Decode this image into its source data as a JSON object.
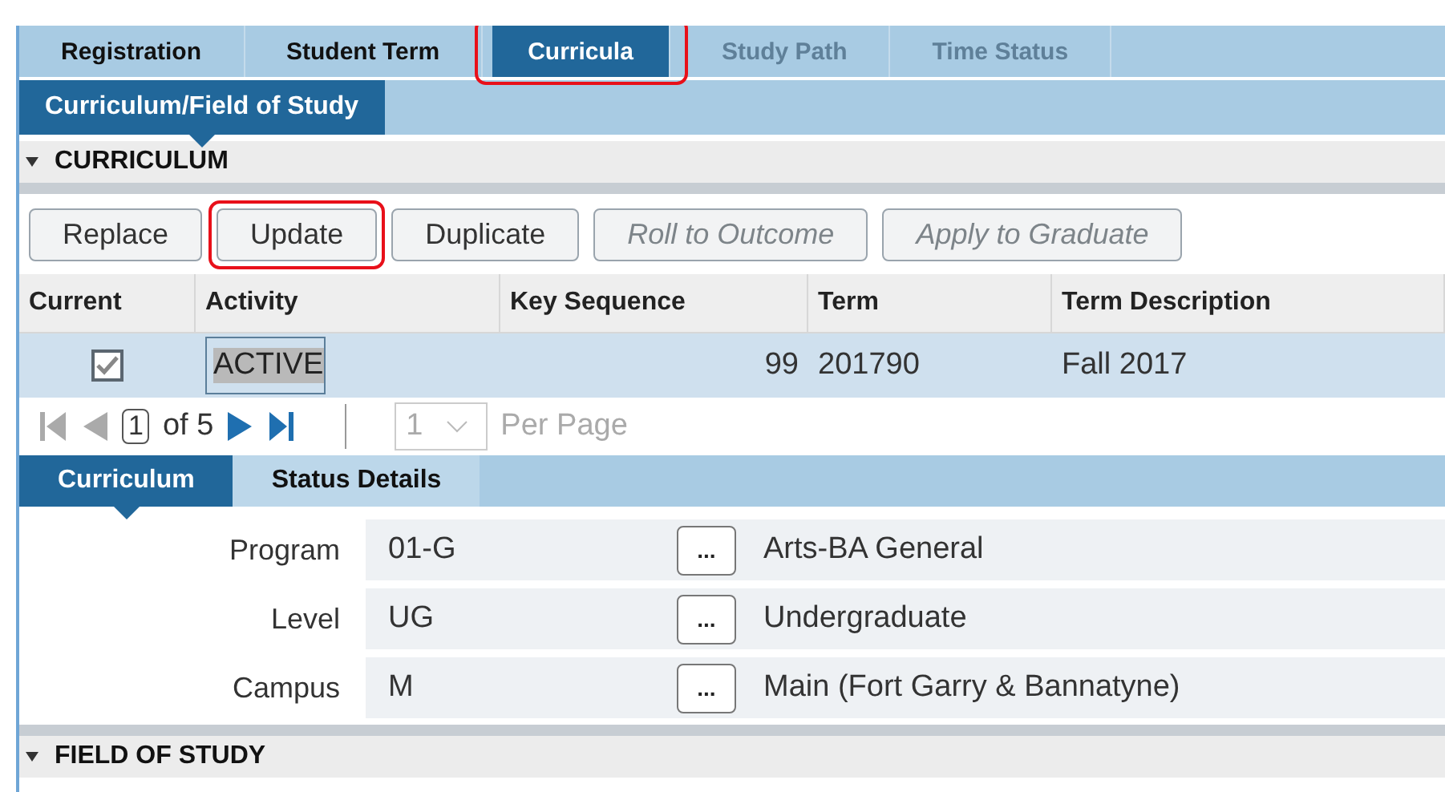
{
  "tabs": [
    {
      "label": "Registration",
      "selected": false,
      "disabled": false,
      "highlighted": false
    },
    {
      "label": "Student Term",
      "selected": false,
      "disabled": false,
      "highlighted": false
    },
    {
      "label": "Curricula",
      "selected": true,
      "disabled": false,
      "highlighted": true
    },
    {
      "label": "Study Path",
      "selected": false,
      "disabled": true,
      "highlighted": false
    },
    {
      "label": "Time Status",
      "selected": false,
      "disabled": true,
      "highlighted": false
    }
  ],
  "subtabs": [
    {
      "label": "Curriculum/Field of Study",
      "selected": true
    }
  ],
  "sections": [
    {
      "title": "CURRICULUM",
      "expanded": true
    },
    {
      "title": "FIELD OF STUDY",
      "expanded": true
    }
  ],
  "buttons": [
    {
      "label": "Replace",
      "disabled": false,
      "highlighted": false
    },
    {
      "label": "Update",
      "disabled": false,
      "highlighted": true
    },
    {
      "label": "Duplicate",
      "disabled": false,
      "highlighted": false
    },
    {
      "label": "Roll to Outcome",
      "disabled": true,
      "highlighted": false
    },
    {
      "label": "Apply to Graduate",
      "disabled": true,
      "highlighted": false
    }
  ],
  "table": {
    "columns": [
      "Current",
      "Activity",
      "Key Sequence",
      "Term",
      "Term Description"
    ],
    "rows": [
      {
        "current": true,
        "activity": "ACTIVE",
        "key_sequence": "99",
        "term": "201790",
        "term_description": "Fall 2017",
        "selected": true
      }
    ]
  },
  "pager": {
    "page": "1",
    "of": "of 5",
    "per_page": "1",
    "per_page_label": "Per Page"
  },
  "detail_tabs": [
    {
      "label": "Curriculum",
      "selected": true
    },
    {
      "label": "Status Details",
      "selected": false
    }
  ],
  "fields": [
    {
      "label": "Program",
      "code": "01-G",
      "button": "...",
      "description": "Arts-BA General"
    },
    {
      "label": "Level",
      "code": "UG",
      "button": "...",
      "description": "Undergraduate"
    },
    {
      "label": "Campus",
      "code": "M",
      "button": "...",
      "description": "Main (Fort Garry & Bannatyne)"
    }
  ]
}
